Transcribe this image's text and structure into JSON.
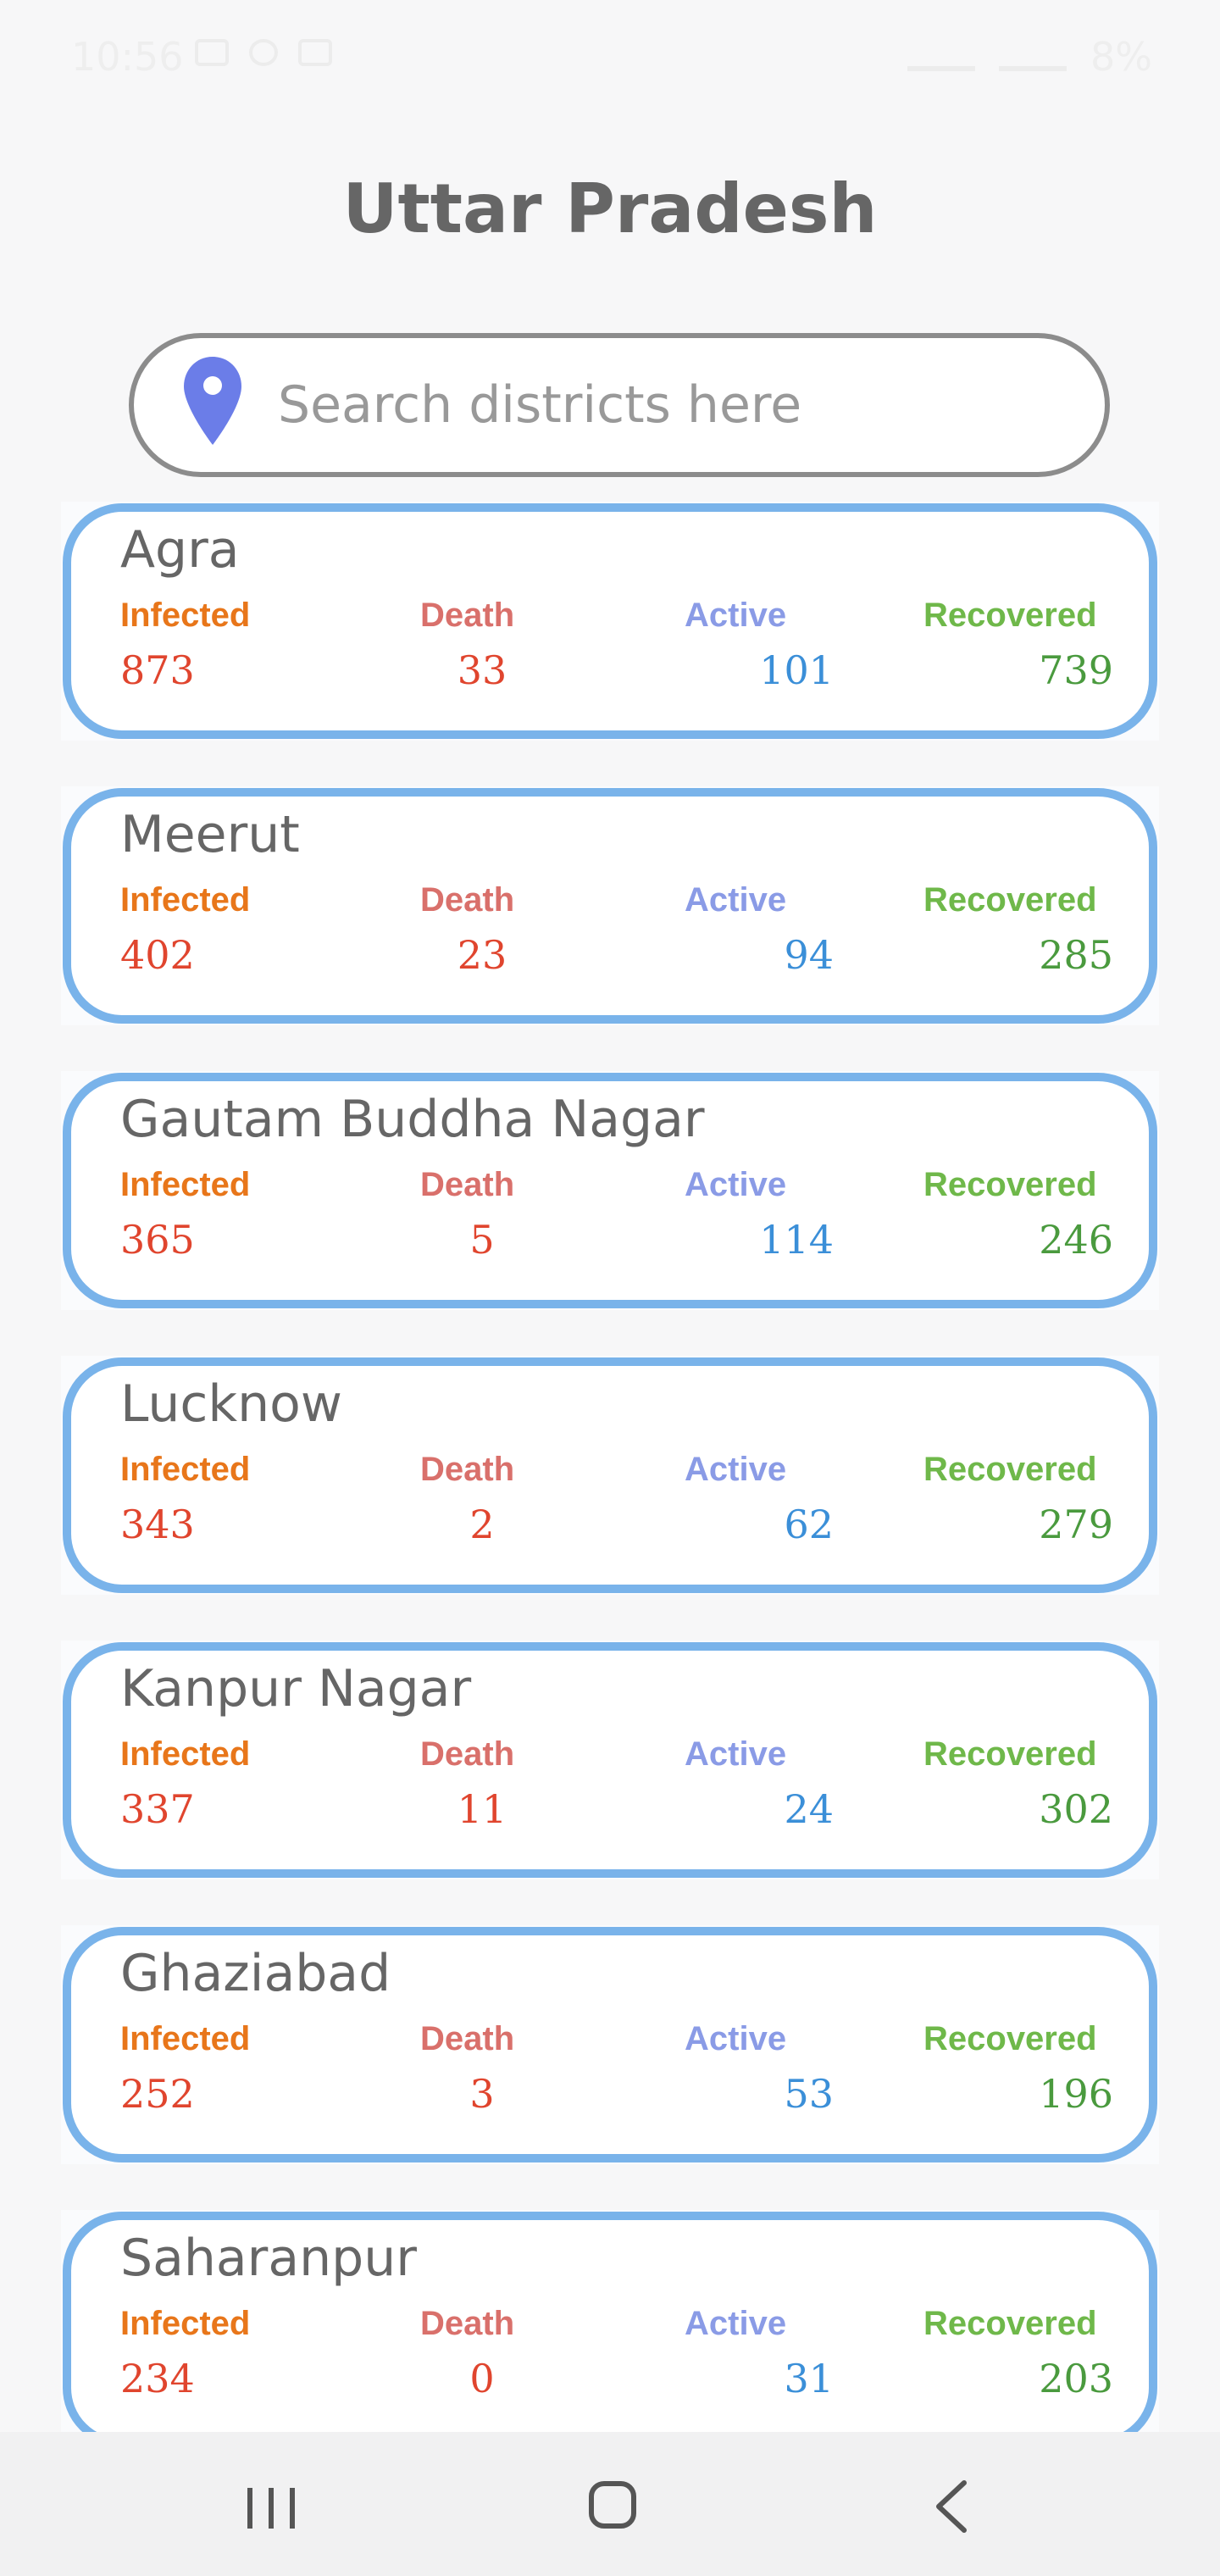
{
  "status_bar": {
    "time": "10:56",
    "battery": "8%"
  },
  "header": {
    "title": "Uttar Pradesh"
  },
  "search": {
    "placeholder": "Search districts here"
  },
  "labels": {
    "infected": "Infected",
    "death": "Death",
    "active": "Active",
    "recovered": "Recovered"
  },
  "districts": [
    {
      "name": "Agra",
      "infected": "873",
      "death": "33",
      "active": "101",
      "recovered": "739"
    },
    {
      "name": "Meerut",
      "infected": "402",
      "death": "23",
      "active": "94",
      "recovered": "285"
    },
    {
      "name": "Gautam Buddha Nagar",
      "infected": "365",
      "death": "5",
      "active": "114",
      "recovered": "246"
    },
    {
      "name": "Lucknow",
      "infected": "343",
      "death": "2",
      "active": "62",
      "recovered": "279"
    },
    {
      "name": "Kanpur Nagar",
      "infected": "337",
      "death": "11",
      "active": "24",
      "recovered": "302"
    },
    {
      "name": "Ghaziabad",
      "infected": "252",
      "death": "3",
      "active": "53",
      "recovered": "196"
    },
    {
      "name": "Saharanpur",
      "infected": "234",
      "death": "0",
      "active": "31",
      "recovered": "203"
    }
  ],
  "colors": {
    "card_border": "#79b3ea",
    "infected": "#e8761a",
    "death": "#d9706b",
    "active": "#8a9be6",
    "recovered": "#6fb84a",
    "pin": "#6b7de8"
  },
  "icons": {
    "search": "location-pin-icon",
    "nav_recent": "recent-apps-icon",
    "nav_home": "home-icon",
    "nav_back": "back-icon"
  }
}
